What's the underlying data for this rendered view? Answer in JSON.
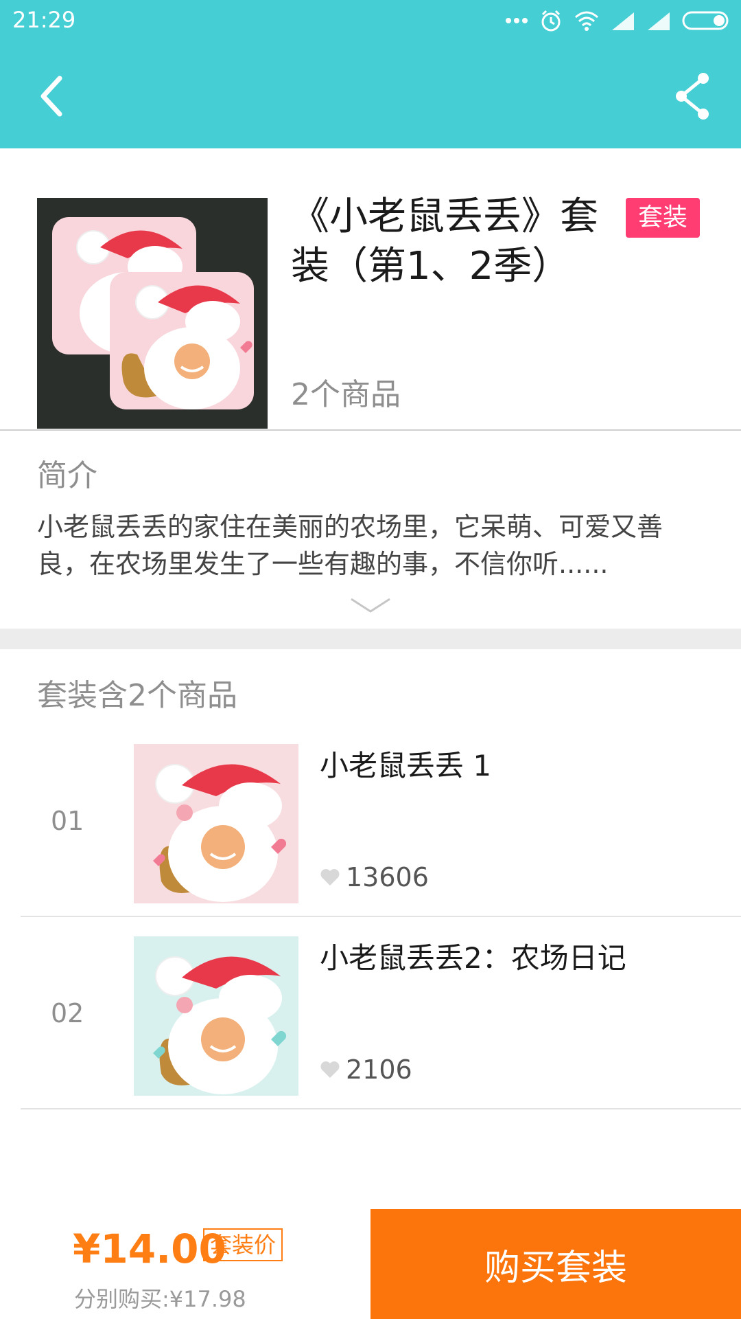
{
  "status_bar": {
    "time": "21:29"
  },
  "header": {
    "back_icon": "chevron-left-icon",
    "share_icon": "share-icon"
  },
  "colors": {
    "header": "#45cfd5",
    "badge": "#ff3d73",
    "accent_orange": "#fb740c",
    "price_orange": "#ff7e14"
  },
  "product": {
    "title": "《小老鼠丢丢》套装（第1、2季）",
    "badge": "套装",
    "item_count": "2个商品"
  },
  "intro": {
    "label": "简介",
    "text": "小老鼠丢丢的家住在美丽的农场里，它呆萌、可爱又善良，在农场里发生了一些有趣的事，不信你听......"
  },
  "bundle": {
    "label": "套装含2个商品",
    "items": [
      {
        "index": "01",
        "title": "小老鼠丢丢 1",
        "likes": "13606"
      },
      {
        "index": "02",
        "title": "小老鼠丢丢2：农场日记",
        "likes": "2106"
      }
    ]
  },
  "footer": {
    "price": "¥14.00",
    "price_tag": "套装价",
    "separate_price": "分别购买:¥17.98",
    "buy_label": "购买套装"
  }
}
